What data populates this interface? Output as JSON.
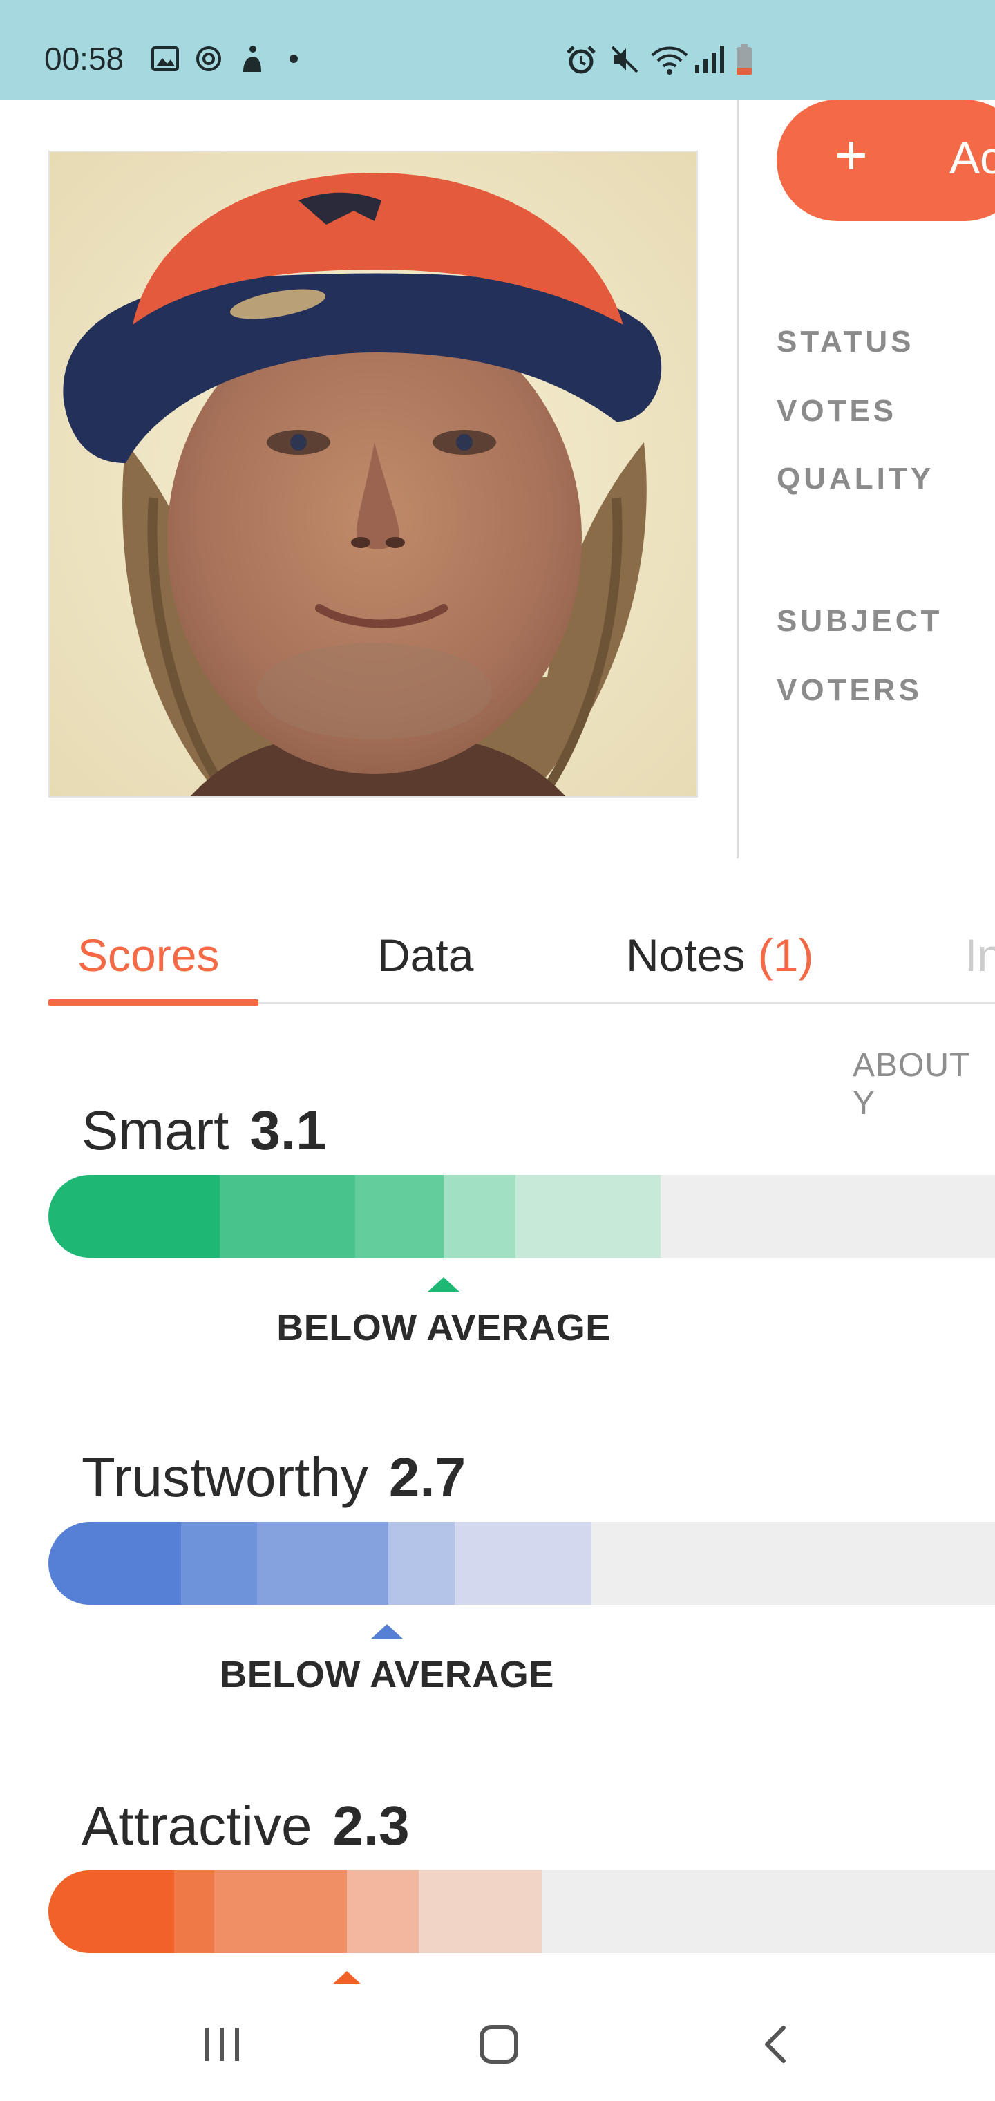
{
  "status_bar": {
    "time": "00:58",
    "icons_left": [
      "image-icon",
      "sync-icon",
      "accessibility-icon",
      "dot-icon"
    ],
    "icons_right": [
      "alarm-icon",
      "mute-icon",
      "wifi-icon",
      "signal-icon",
      "battery-icon"
    ]
  },
  "profile": {
    "photo_alt": "selfie-photo",
    "add_button_label": "Ac",
    "add_button_icon": "plus-icon",
    "stats": [
      "STATUS",
      "VOTES",
      "QUALITY",
      "SUBJECT",
      "VOTERS"
    ]
  },
  "tabs": [
    {
      "label": "Scores",
      "count": ""
    },
    {
      "label": "Data",
      "count": ""
    },
    {
      "label": "Notes",
      "count": "(1)"
    },
    {
      "label": "In",
      "count": ""
    }
  ],
  "about_label": "ABOUT Y",
  "scores": [
    {
      "label": "Smart",
      "value": "3.1",
      "verdict": "BELOW AVERAGE",
      "marker_level": 0.42,
      "color": "#1fb774"
    },
    {
      "label": "Trustworthy",
      "value": "2.7",
      "verdict": "BELOW AVERAGE",
      "marker_level": 0.34,
      "color": "#5580d6"
    },
    {
      "label": "Attractive",
      "value": "2.3",
      "verdict": "",
      "marker_level": 0.32,
      "color": "#f0622a"
    }
  ],
  "nav": {
    "recent_icon": "recent-apps-icon",
    "home_icon": "home-icon",
    "back_icon": "back-icon"
  },
  "colors": {
    "accent": "#f56a46",
    "status_bar": "#a5d8df",
    "smart": "#1fb774",
    "trust": "#5580d6",
    "attractive": "#f0622a"
  }
}
